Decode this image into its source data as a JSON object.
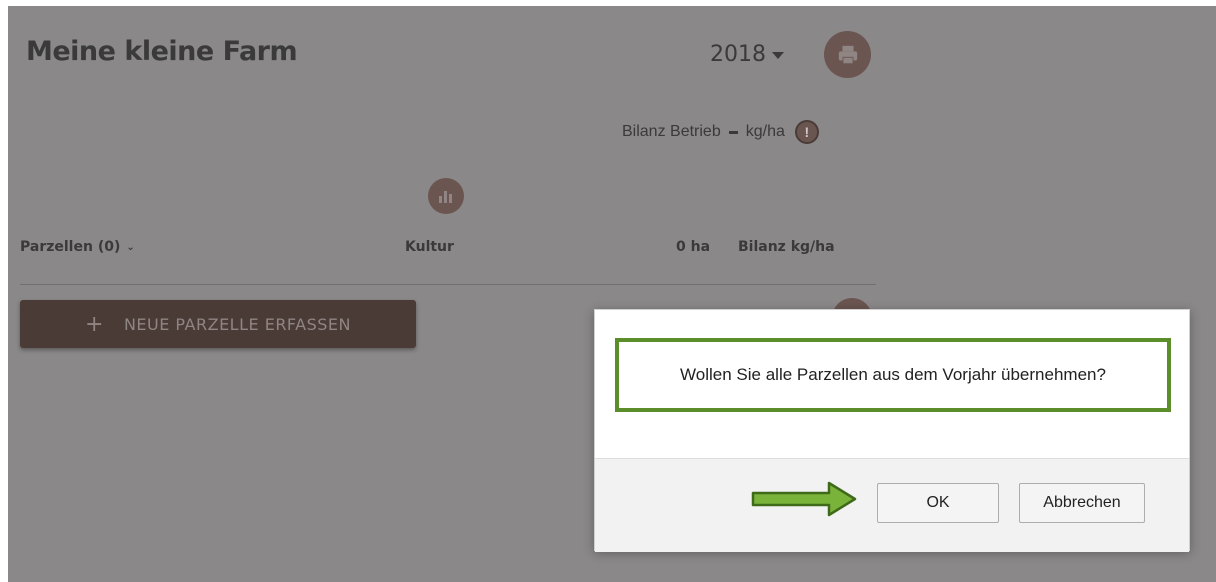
{
  "header": {
    "title": "Meine kleine Farm",
    "year": "2018"
  },
  "summary": {
    "label": "Bilanz Betrieb",
    "unit": "kg/ha"
  },
  "table": {
    "col_parzellen": "Parzellen (0)",
    "col_kultur": "Kultur",
    "col_ha": "0 ha",
    "col_bilanz": "Bilanz kg/ha"
  },
  "actions": {
    "add_label": "NEUE PARZELLE ERFASSEN"
  },
  "modal": {
    "message": "Wollen Sie alle Parzellen aus dem Vorjahr übernehmen?",
    "ok_label": "OK",
    "cancel_label": "Abbrechen"
  },
  "icons": {
    "print": "print-icon",
    "chart": "bar-chart-icon",
    "info": "info-icon",
    "arrow": "arrow-right-icon"
  },
  "colors": {
    "overlay_gray": "#8a8888",
    "brand_brown": "#4a3b37",
    "highlight_green": "#5c8d2b"
  }
}
